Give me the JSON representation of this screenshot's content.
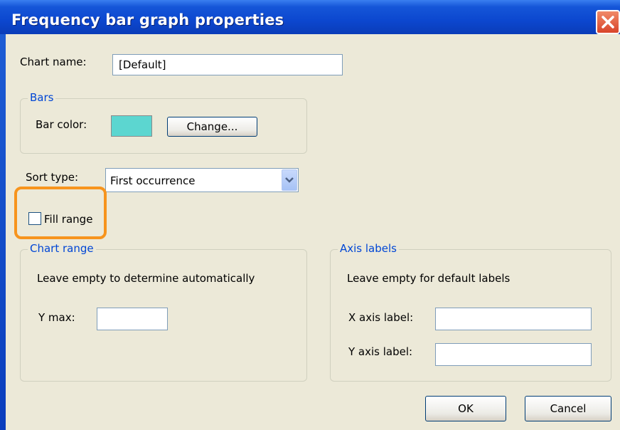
{
  "window": {
    "title": "Frequency bar graph properties",
    "close_icon": "close-icon"
  },
  "chart_name": {
    "label": "Chart name:",
    "value": "[Default]"
  },
  "bars": {
    "group_label": "Bars",
    "bar_color_label": "Bar color:",
    "bar_color": "#5cd6d0",
    "change_button": "Change..."
  },
  "sort": {
    "label": "Sort type:",
    "selected": "First occurrence",
    "arrow_icon": "chevron-down-icon"
  },
  "fill_range": {
    "label": "Fill range",
    "checked": false,
    "highlight_color": "#f7941d"
  },
  "chart_range": {
    "group_label": "Chart range",
    "hint": "Leave empty to determine automatically",
    "ymax_label": "Y max:",
    "ymax_value": ""
  },
  "axis_labels": {
    "group_label": "Axis labels",
    "hint": "Leave empty for default labels",
    "x_label": "X axis label:",
    "x_value": "",
    "y_label": "Y axis label:",
    "y_value": ""
  },
  "buttons": {
    "ok": "OK",
    "cancel": "Cancel"
  }
}
